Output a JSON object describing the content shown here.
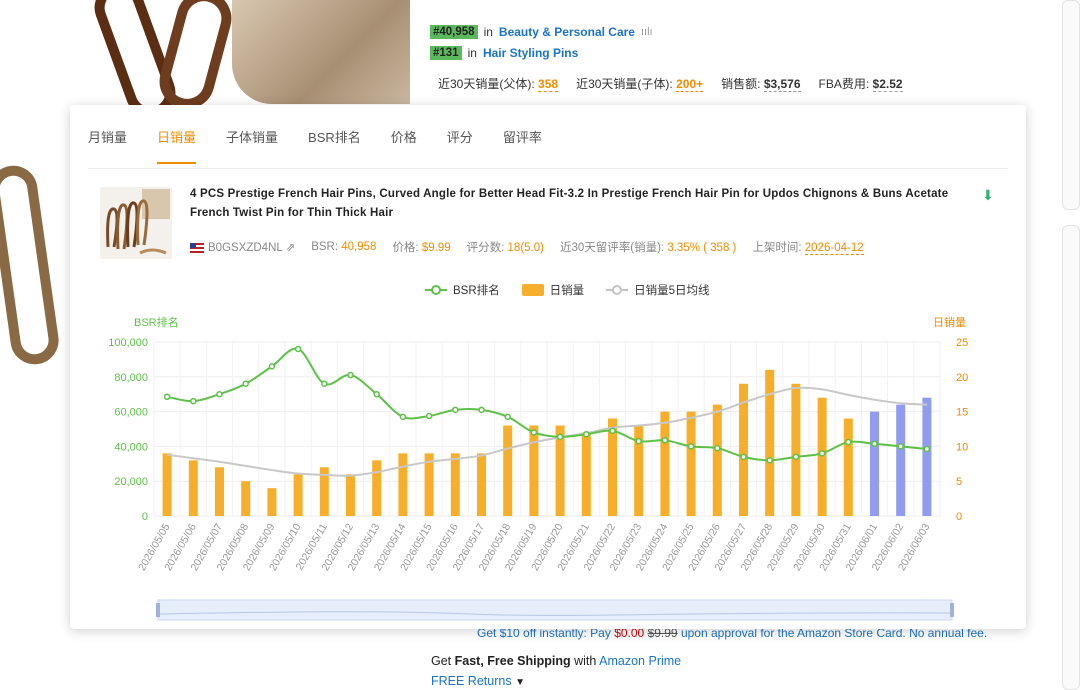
{
  "background": {
    "ranks": [
      {
        "badge": "#40,958",
        "text_in": "in",
        "category": "Beauty & Personal Care"
      },
      {
        "badge": "#131",
        "text_in": "in",
        "category": "Hair Styling Pins"
      }
    ],
    "stats": [
      {
        "label": "近30天销量(父体):",
        "value": "358"
      },
      {
        "label": "近30天销量(子体):",
        "value": "200+"
      },
      {
        "label": "销售额:",
        "value": "$3,576"
      },
      {
        "label": "FBA费用:",
        "value": "$2.52"
      }
    ],
    "offer_prefix": "Get $10 off instantly: Pay",
    "offer_price": "$0.00",
    "offer_strike": "$9.99",
    "offer_suffix": "upon approval for the Amazon Store Card. No annual fee.",
    "shipping_prefix": "Get",
    "shipping_bold": "Fast, Free Shipping",
    "shipping_with": "with",
    "shipping_prime": "Amazon Prime",
    "returns": "FREE Returns"
  },
  "panel": {
    "tabs": [
      "月销量",
      "日销量",
      "子体销量",
      "BSR排名",
      "价格",
      "评分",
      "留评率"
    ],
    "active_tab": 1,
    "product": {
      "title": "4 PCS Prestige French Hair Pins, Curved Angle for Better Head Fit-3.2 In Prestige French Hair Pin for Updos Chignons & Buns Acetate French Twist Pin for Thin Thick Hair",
      "asin": "B0GSXZD4NL",
      "bsr_label": "BSR:",
      "bsr": "40,958",
      "price_label": "价格:",
      "price": "$9.99",
      "rating_label": "评分数:",
      "rating": "18(5.0)",
      "review_rate_label": "近30天留评率(销量):",
      "review_rate": "3.35% ( 358 )",
      "listed_label": "上架时间:",
      "listed": "2026-04-12"
    },
    "legend": {
      "bsr": "BSR排名",
      "bar": "日销量",
      "ma": "日销量5日均线"
    }
  },
  "colors": {
    "accent": "#f08c00",
    "bar": "#f7ae2a",
    "bar_forecast": "#8f9cf0",
    "bsr_line": "#5cc146",
    "ma_line": "#c8c8c8"
  },
  "chart_data": {
    "type": "bar",
    "left_axis_title": "BSR排名",
    "right_axis_title": "日销量",
    "left_ticks": [
      "0",
      "20,000",
      "40,000",
      "60,000",
      "80,000",
      "100,000"
    ],
    "right_ticks": [
      "0",
      "5",
      "10",
      "15",
      "20",
      "25"
    ],
    "ylim_left": [
      0,
      100000
    ],
    "ylim_right": [
      0,
      25
    ],
    "categories": [
      "2026/05/05",
      "2026/05/06",
      "2026/05/07",
      "2026/05/08",
      "2026/05/09",
      "2026/05/10",
      "2026/05/11",
      "2026/05/12",
      "2026/05/13",
      "2026/05/14",
      "2026/05/15",
      "2026/05/16",
      "2026/05/17",
      "2026/05/18",
      "2026/05/19",
      "2026/05/20",
      "2026/05/21",
      "2026/05/22",
      "2026/05/23",
      "2026/05/24",
      "2026/05/25",
      "2026/05/26",
      "2026/05/27",
      "2026/05/28",
      "2026/05/29",
      "2026/05/30",
      "2026/05/31",
      "2026/06/01",
      "2026/06/02",
      "2026/06/03"
    ],
    "series": [
      {
        "name": "日销量",
        "axis": "right",
        "values": [
          9,
          8,
          7,
          5,
          4,
          6,
          7,
          6,
          8,
          9,
          9,
          9,
          9,
          13,
          13,
          13,
          12,
          14,
          13,
          15,
          15,
          16,
          19,
          21,
          19,
          17,
          14,
          15,
          16,
          17
        ]
      },
      {
        "name": "BSR排名",
        "axis": "left",
        "values": [
          68500,
          66000,
          70000,
          76000,
          86000,
          96000,
          76000,
          81000,
          70000,
          57000,
          57500,
          61000,
          61000,
          57000,
          48000,
          45500,
          47000,
          49000,
          43000,
          43500,
          40000,
          39000,
          34000,
          32000,
          34000,
          36000,
          42500,
          41500,
          40000,
          38500
        ]
      },
      {
        "name": "日销量5日均线",
        "axis": "right",
        "values": [
          8.8,
          8.3,
          7.8,
          7.2,
          6.6,
          6.1,
          5.9,
          5.8,
          6.3,
          7.1,
          7.8,
          8.2,
          8.7,
          9.7,
          10.6,
          11.3,
          11.9,
          12.7,
          13.0,
          13.4,
          14.1,
          15.0,
          16.3,
          17.5,
          18.4,
          18.2,
          17.4,
          16.7,
          16.2,
          16.0
        ]
      }
    ],
    "forecast_from_index": 27,
    "grid": true,
    "legend_position": "top-center"
  }
}
